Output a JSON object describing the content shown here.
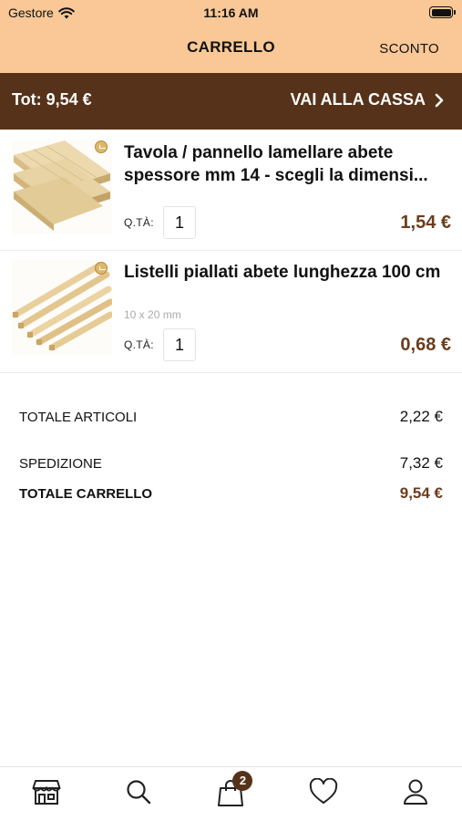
{
  "status_bar": {
    "carrier": "Gestore",
    "time": "11:16 AM"
  },
  "header": {
    "title": "CARRELLO",
    "discount_label": "SCONTO"
  },
  "checkout_bar": {
    "total": "Tot: 9,54 €",
    "checkout_label": "VAI ALLA CASSA"
  },
  "items": [
    {
      "title": "Tavola / pannello lamellare abete spessore mm 14 - scegli la dimensi...",
      "variant": "",
      "qty_label": "Q.TÀ:",
      "qty": "1",
      "price": "1,54 €"
    },
    {
      "title": "Listelli piallati abete  lunghezza 100 cm",
      "variant": "10 x  20 mm",
      "qty_label": "Q.TÀ:",
      "qty": "1",
      "price": "0,68 €"
    }
  ],
  "summary": {
    "articles_label": "TOTALE ARTICOLI",
    "articles_value": "2,22 €",
    "shipping_label": "SPEDIZIONE",
    "shipping_value": "7,32 €",
    "total_label": "TOTALE CARRELLO",
    "total_value": "9,54 €"
  },
  "tabbar": {
    "tabs": [
      "store-icon",
      "search-icon",
      "cart-icon",
      "heart-icon",
      "user-icon"
    ],
    "cart_badge": "2"
  },
  "colors": {
    "header_bg": "#f9c896",
    "brand_brown": "#56321a",
    "price_brown": "#6b3d1d"
  }
}
